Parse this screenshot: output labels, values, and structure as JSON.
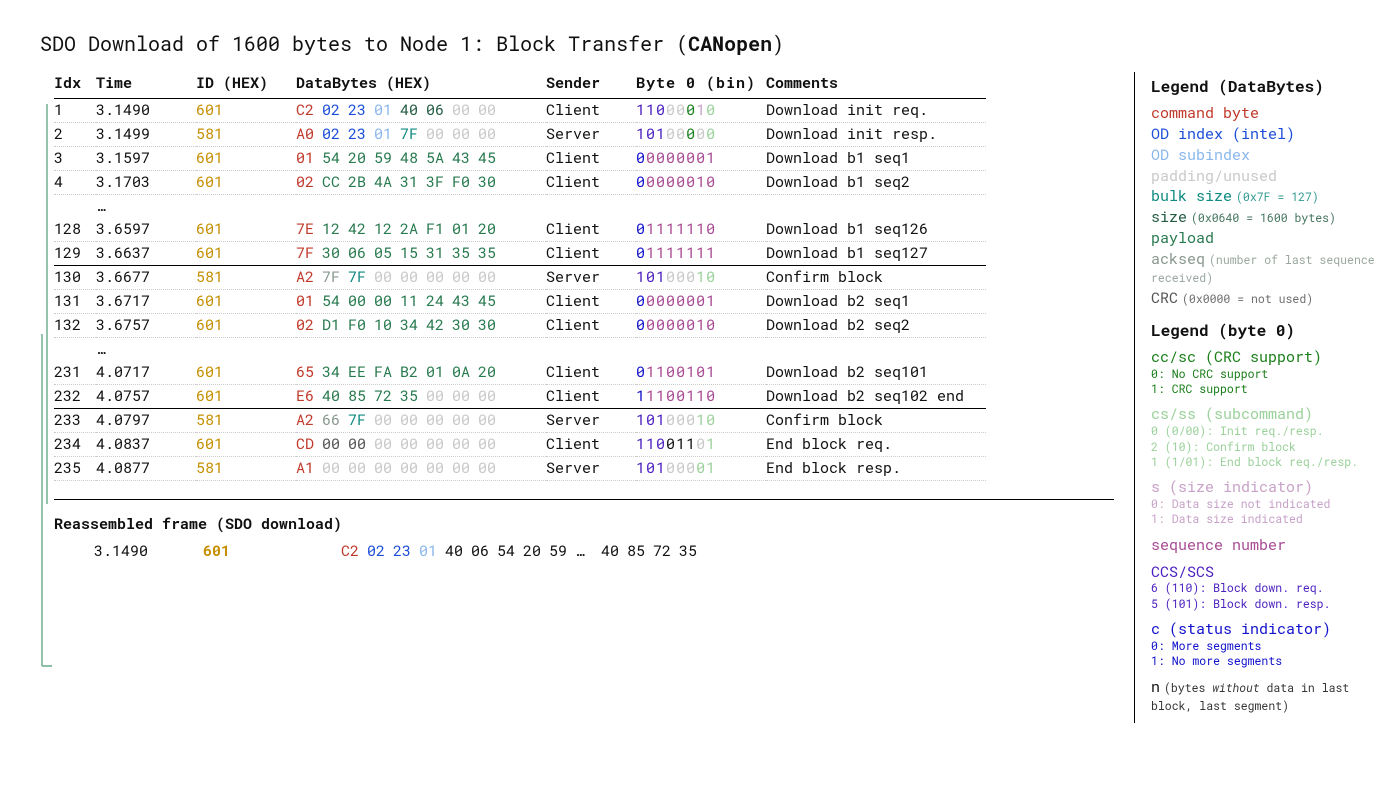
{
  "title_pre": "SDO Download of 1600 bytes to Node 1: Block Transfer (",
  "title_strong": "CANopen",
  "title_post": ")",
  "cols": {
    "idx": "Idx",
    "time": "Time",
    "id": "ID (HEX)",
    "bytes": "DataBytes (HEX)",
    "sender": "Sender",
    "byte0": "Byte 0 (bin)",
    "comment": "Comments"
  },
  "rows": [
    {
      "idx": "1",
      "time": "3.1490",
      "id": "601",
      "sender": "Client",
      "comment": "Download init req.",
      "bytes": [
        [
          "C2",
          "cmd"
        ],
        [
          "02",
          "odidx"
        ],
        [
          "23",
          "odidx"
        ],
        [
          "01",
          "odsub"
        ],
        [
          "40",
          "size"
        ],
        [
          "06",
          "size"
        ],
        [
          "00",
          "pad"
        ],
        [
          "00",
          "pad"
        ]
      ],
      "byte0": [
        [
          "1",
          "ccs"
        ],
        [
          "1",
          "ccs"
        ],
        [
          "0",
          "ccs"
        ],
        [
          "0",
          "pad"
        ],
        [
          "0",
          "pad"
        ],
        [
          "0",
          "cc"
        ],
        [
          "1",
          "s"
        ],
        [
          "0",
          "cs"
        ]
      ]
    },
    {
      "idx": "2",
      "time": "3.1499",
      "id": "581",
      "sender": "Server",
      "comment": "Download init resp.",
      "bytes": [
        [
          "A0",
          "cmd"
        ],
        [
          "02",
          "odidx"
        ],
        [
          "23",
          "odidx"
        ],
        [
          "01",
          "odsub"
        ],
        [
          "7F",
          "blksize"
        ],
        [
          "00",
          "pad"
        ],
        [
          "00",
          "pad"
        ],
        [
          "00",
          "pad"
        ]
      ],
      "byte0": [
        [
          "1",
          "ccs"
        ],
        [
          "0",
          "ccs"
        ],
        [
          "1",
          "ccs"
        ],
        [
          "0",
          "pad"
        ],
        [
          "0",
          "pad"
        ],
        [
          "0",
          "cc"
        ],
        [
          "0",
          "pad"
        ],
        [
          "0",
          "cs"
        ]
      ]
    },
    {
      "idx": "3",
      "time": "3.1597",
      "id": "601",
      "sender": "Client",
      "comment": "Download b1 seq1",
      "bytes": [
        [
          "01",
          "cmd"
        ],
        [
          "54",
          "payload"
        ],
        [
          "20",
          "payload"
        ],
        [
          "59",
          "payload"
        ],
        [
          "48",
          "payload"
        ],
        [
          "5A",
          "payload"
        ],
        [
          "43",
          "payload"
        ],
        [
          "45",
          "payload"
        ]
      ],
      "byte0": [
        [
          "0",
          "c"
        ],
        [
          "0",
          "seq"
        ],
        [
          "0",
          "seq"
        ],
        [
          "0",
          "seq"
        ],
        [
          "0",
          "seq"
        ],
        [
          "0",
          "seq"
        ],
        [
          "0",
          "seq"
        ],
        [
          "1",
          "seq"
        ]
      ]
    },
    {
      "idx": "4",
      "time": "3.1703",
      "id": "601",
      "sender": "Client",
      "comment": "Download b1 seq2",
      "bytes": [
        [
          "02",
          "cmd"
        ],
        [
          "CC",
          "payload"
        ],
        [
          "2B",
          "payload"
        ],
        [
          "4A",
          "payload"
        ],
        [
          "31",
          "payload"
        ],
        [
          "3F",
          "payload"
        ],
        [
          "F0",
          "payload"
        ],
        [
          "30",
          "payload"
        ]
      ],
      "byte0": [
        [
          "0",
          "c"
        ],
        [
          "0",
          "seq"
        ],
        [
          "0",
          "seq"
        ],
        [
          "0",
          "seq"
        ],
        [
          "0",
          "seq"
        ],
        [
          "0",
          "seq"
        ],
        [
          "1",
          "seq"
        ],
        [
          "0",
          "seq"
        ]
      ]
    },
    {
      "ellipsis": true
    },
    {
      "idx": "128",
      "time": "3.6597",
      "id": "601",
      "sender": "Client",
      "comment": "Download b1 seq126",
      "bytes": [
        [
          "7E",
          "cmd"
        ],
        [
          "12",
          "payload"
        ],
        [
          "42",
          "payload"
        ],
        [
          "12",
          "payload"
        ],
        [
          "2A",
          "payload"
        ],
        [
          "F1",
          "payload"
        ],
        [
          "01",
          "payload"
        ],
        [
          "20",
          "payload"
        ]
      ],
      "byte0": [
        [
          "0",
          "c"
        ],
        [
          "1",
          "seq"
        ],
        [
          "1",
          "seq"
        ],
        [
          "1",
          "seq"
        ],
        [
          "1",
          "seq"
        ],
        [
          "1",
          "seq"
        ],
        [
          "1",
          "seq"
        ],
        [
          "0",
          "seq"
        ]
      ]
    },
    {
      "idx": "129",
      "time": "3.6637",
      "id": "601",
      "sender": "Client",
      "comment": "Download b1 seq127",
      "bytes": [
        [
          "7F",
          "cmd"
        ],
        [
          "30",
          "payload"
        ],
        [
          "06",
          "payload"
        ],
        [
          "05",
          "payload"
        ],
        [
          "15",
          "payload"
        ],
        [
          "31",
          "payload"
        ],
        [
          "35",
          "payload"
        ],
        [
          "35",
          "payload"
        ]
      ],
      "byte0": [
        [
          "0",
          "c"
        ],
        [
          "1",
          "seq"
        ],
        [
          "1",
          "seq"
        ],
        [
          "1",
          "seq"
        ],
        [
          "1",
          "seq"
        ],
        [
          "1",
          "seq"
        ],
        [
          "1",
          "seq"
        ],
        [
          "1",
          "seq"
        ]
      ],
      "group_end": true
    },
    {
      "idx": "130",
      "time": "3.6677",
      "id": "581",
      "sender": "Server",
      "comment": "Confirm block",
      "bytes": [
        [
          "A2",
          "cmd"
        ],
        [
          "7F",
          "ackseq"
        ],
        [
          "7F",
          "blksize"
        ],
        [
          "00",
          "pad"
        ],
        [
          "00",
          "pad"
        ],
        [
          "00",
          "pad"
        ],
        [
          "00",
          "pad"
        ],
        [
          "00",
          "pad"
        ]
      ],
      "byte0": [
        [
          "1",
          "ccs"
        ],
        [
          "0",
          "ccs"
        ],
        [
          "1",
          "ccs"
        ],
        [
          "0",
          "pad"
        ],
        [
          "0",
          "pad"
        ],
        [
          "0",
          "pad"
        ],
        [
          "1",
          "cs"
        ],
        [
          "0",
          "cs"
        ]
      ]
    },
    {
      "idx": "131",
      "time": "3.6717",
      "id": "601",
      "sender": "Client",
      "comment": "Download b2 seq1",
      "bytes": [
        [
          "01",
          "cmd"
        ],
        [
          "54",
          "payload"
        ],
        [
          "00",
          "payload"
        ],
        [
          "00",
          "payload"
        ],
        [
          "11",
          "payload"
        ],
        [
          "24",
          "payload"
        ],
        [
          "43",
          "payload"
        ],
        [
          "45",
          "payload"
        ]
      ],
      "byte0": [
        [
          "0",
          "c"
        ],
        [
          "0",
          "seq"
        ],
        [
          "0",
          "seq"
        ],
        [
          "0",
          "seq"
        ],
        [
          "0",
          "seq"
        ],
        [
          "0",
          "seq"
        ],
        [
          "0",
          "seq"
        ],
        [
          "1",
          "seq"
        ]
      ]
    },
    {
      "idx": "132",
      "time": "3.6757",
      "id": "601",
      "sender": "Client",
      "comment": "Download b2 seq2",
      "bytes": [
        [
          "02",
          "cmd"
        ],
        [
          "D1",
          "payload"
        ],
        [
          "F0",
          "payload"
        ],
        [
          "10",
          "payload"
        ],
        [
          "34",
          "payload"
        ],
        [
          "42",
          "payload"
        ],
        [
          "30",
          "payload"
        ],
        [
          "30",
          "payload"
        ]
      ],
      "byte0": [
        [
          "0",
          "c"
        ],
        [
          "0",
          "seq"
        ],
        [
          "0",
          "seq"
        ],
        [
          "0",
          "seq"
        ],
        [
          "0",
          "seq"
        ],
        [
          "0",
          "seq"
        ],
        [
          "1",
          "seq"
        ],
        [
          "0",
          "seq"
        ]
      ]
    },
    {
      "ellipsis": true
    },
    {
      "idx": "231",
      "time": "4.0717",
      "id": "601",
      "sender": "Client",
      "comment": "Download b2 seq101",
      "bytes": [
        [
          "65",
          "cmd"
        ],
        [
          "34",
          "payload"
        ],
        [
          "EE",
          "payload"
        ],
        [
          "FA",
          "payload"
        ],
        [
          "B2",
          "payload"
        ],
        [
          "01",
          "payload"
        ],
        [
          "0A",
          "payload"
        ],
        [
          "20",
          "payload"
        ]
      ],
      "byte0": [
        [
          "0",
          "c"
        ],
        [
          "1",
          "seq"
        ],
        [
          "1",
          "seq"
        ],
        [
          "0",
          "seq"
        ],
        [
          "0",
          "seq"
        ],
        [
          "1",
          "seq"
        ],
        [
          "0",
          "seq"
        ],
        [
          "1",
          "seq"
        ]
      ]
    },
    {
      "idx": "232",
      "time": "4.0757",
      "id": "601",
      "sender": "Client",
      "comment": "Download b2 seq102 end",
      "bytes": [
        [
          "E6",
          "cmd"
        ],
        [
          "40",
          "payload"
        ],
        [
          "85",
          "payload"
        ],
        [
          "72",
          "payload"
        ],
        [
          "35",
          "payload"
        ],
        [
          "00",
          "pad"
        ],
        [
          "00",
          "pad"
        ],
        [
          "00",
          "pad"
        ]
      ],
      "byte0": [
        [
          "1",
          "c"
        ],
        [
          "1",
          "seq"
        ],
        [
          "1",
          "seq"
        ],
        [
          "0",
          "seq"
        ],
        [
          "0",
          "seq"
        ],
        [
          "1",
          "seq"
        ],
        [
          "1",
          "seq"
        ],
        [
          "0",
          "seq"
        ]
      ],
      "group_end": true
    },
    {
      "idx": "233",
      "time": "4.0797",
      "id": "581",
      "sender": "Server",
      "comment": "Confirm block",
      "bytes": [
        [
          "A2",
          "cmd"
        ],
        [
          "66",
          "ackseq"
        ],
        [
          "7F",
          "blksize"
        ],
        [
          "00",
          "pad"
        ],
        [
          "00",
          "pad"
        ],
        [
          "00",
          "pad"
        ],
        [
          "00",
          "pad"
        ],
        [
          "00",
          "pad"
        ]
      ],
      "byte0": [
        [
          "1",
          "ccs"
        ],
        [
          "0",
          "ccs"
        ],
        [
          "1",
          "ccs"
        ],
        [
          "0",
          "pad"
        ],
        [
          "0",
          "pad"
        ],
        [
          "0",
          "pad"
        ],
        [
          "1",
          "cs"
        ],
        [
          "0",
          "cs"
        ]
      ]
    },
    {
      "idx": "234",
      "time": "4.0837",
      "id": "601",
      "sender": "Client",
      "comment": "End block req.",
      "bytes": [
        [
          "CD",
          "cmd"
        ],
        [
          "00",
          "crc"
        ],
        [
          "00",
          "crc"
        ],
        [
          "00",
          "pad"
        ],
        [
          "00",
          "pad"
        ],
        [
          "00",
          "pad"
        ],
        [
          "00",
          "pad"
        ],
        [
          "00",
          "pad"
        ]
      ],
      "byte0": [
        [
          "1",
          "ccs"
        ],
        [
          "1",
          "ccs"
        ],
        [
          "0",
          "ccs"
        ],
        [
          "0",
          "n"
        ],
        [
          "1",
          "n"
        ],
        [
          "1",
          "n"
        ],
        [
          "0",
          "pad"
        ],
        [
          "1",
          "cs"
        ]
      ]
    },
    {
      "idx": "235",
      "time": "4.0877",
      "id": "581",
      "sender": "Server",
      "comment": "End block resp.",
      "bytes": [
        [
          "A1",
          "cmd"
        ],
        [
          "00",
          "pad"
        ],
        [
          "00",
          "pad"
        ],
        [
          "00",
          "pad"
        ],
        [
          "00",
          "pad"
        ],
        [
          "00",
          "pad"
        ],
        [
          "00",
          "pad"
        ],
        [
          "00",
          "pad"
        ]
      ],
      "byte0": [
        [
          "1",
          "ccs"
        ],
        [
          "0",
          "ccs"
        ],
        [
          "1",
          "ccs"
        ],
        [
          "0",
          "pad"
        ],
        [
          "0",
          "pad"
        ],
        [
          "0",
          "pad"
        ],
        [
          "0",
          "cs"
        ],
        [
          "1",
          "cs"
        ]
      ]
    }
  ],
  "reasm": {
    "title": "Reassembled frame (SDO download)",
    "time": "3.1490",
    "id": "601",
    "bytes": [
      [
        "C2",
        "cmd"
      ],
      [
        "02",
        "odidx"
      ],
      [
        "23",
        "odidx"
      ],
      [
        "01",
        "odsub"
      ],
      [
        "40",
        "n"
      ],
      [
        "06",
        "n"
      ],
      [
        "54",
        "n"
      ],
      [
        "20",
        "n"
      ],
      [
        "59",
        "n"
      ],
      [
        "…",
        "n"
      ],
      [
        "40",
        "n"
      ],
      [
        "85",
        "n"
      ],
      [
        "72",
        "n"
      ],
      [
        "35",
        "n"
      ]
    ]
  },
  "legend_db": {
    "title": "Legend (DataBytes)",
    "items": [
      {
        "term": "command byte",
        "cls": "cmd"
      },
      {
        "term": "OD index (intel)",
        "cls": "odidx"
      },
      {
        "term": "OD subindex",
        "cls": "odsub"
      },
      {
        "term": "padding/unused",
        "cls": "pad"
      },
      {
        "term": "bulk size",
        "cls": "blksize",
        "aux": "(0x7F = 127)"
      },
      {
        "term": "size",
        "cls": "size",
        "aux": "(0x0640 = 1600 bytes)"
      },
      {
        "term": "payload",
        "cls": "payload"
      },
      {
        "term": "ackseq",
        "cls": "ackseq",
        "aux": "(number of last sequence received)"
      },
      {
        "term": "CRC",
        "cls": "crc",
        "aux": "(0x0000 = not used)"
      }
    ]
  },
  "legend_b0": {
    "title": "Legend (byte 0)",
    "items": [
      {
        "term": "cc/sc (CRC support)",
        "cls": "cc",
        "sub": [
          "0: No CRC support",
          "1: CRC support"
        ]
      },
      {
        "term": "cs/ss (subcommand)",
        "cls": "cs",
        "sub": [
          "0 (0/00): Init req./resp.",
          "2 (10): Confirm block",
          "1 (1/01): End block req./resp."
        ]
      },
      {
        "term": "s (size indicator)",
        "cls": "s",
        "sub": [
          "0: Data size not indicated",
          "1: Data size indicated"
        ]
      },
      {
        "term": "sequence number",
        "cls": "seq"
      },
      {
        "term": "CCS/SCS",
        "cls": "ccs",
        "sub": [
          "6 (110): Block down. req.",
          "5 (101): Block down. resp."
        ]
      },
      {
        "term": "c (status indicator)",
        "cls": "c",
        "sub": [
          "0: More segments",
          "1: No more segments"
        ]
      },
      {
        "term": "n",
        "cls": "n",
        "aux_html": "(bytes <em>without</em> data in last block, last segment)"
      }
    ]
  }
}
